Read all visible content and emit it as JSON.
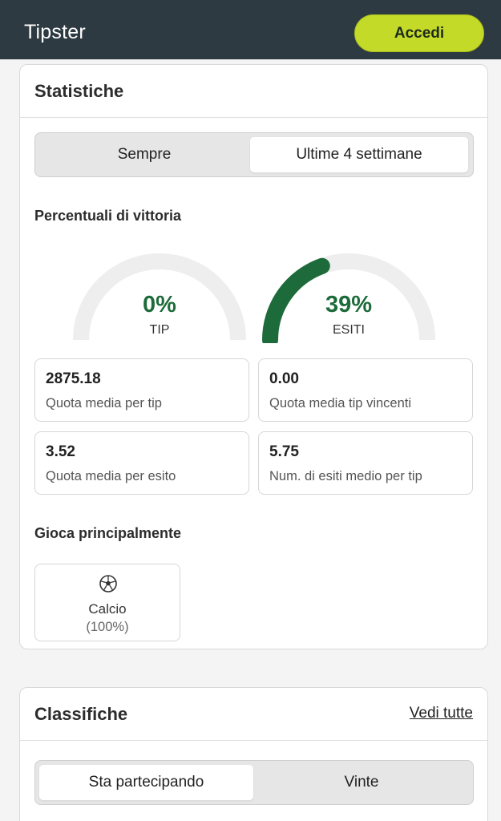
{
  "header": {
    "title": "Tipster",
    "login_label": "Accedi"
  },
  "stats_card": {
    "title": "Statistiche",
    "period_tabs": [
      {
        "label": "Sempre",
        "active": false
      },
      {
        "label": "Ultime 4 settimane",
        "active": true
      }
    ],
    "win_section_title": "Percentuali di vittoria",
    "gauges": [
      {
        "value": "0%",
        "label": "TIP",
        "fraction": 0.0
      },
      {
        "value": "39%",
        "label": "ESITI",
        "fraction": 0.39
      }
    ],
    "gauge_colors": {
      "track": "#eeeeee",
      "fill": "#1d6b3a"
    },
    "metrics": [
      {
        "value": "2875.18",
        "label": "Quota media per tip"
      },
      {
        "value": "0.00",
        "label": "Quota media tip vincenti"
      },
      {
        "value": "3.52",
        "label": "Quota media per esito"
      },
      {
        "value": "5.75",
        "label": "Num. di esiti medio per tip"
      }
    ],
    "plays_section_title": "Gioca principalmente",
    "sports": [
      {
        "icon": "soccer-ball-icon",
        "name": "Calcio",
        "share": "(100%)"
      }
    ]
  },
  "rank_card": {
    "title": "Classifiche",
    "see_all_label": "Vedi tutte",
    "tabs": [
      {
        "label": "Sta partecipando",
        "active": true
      },
      {
        "label": "Vinte",
        "active": false
      }
    ]
  },
  "colors": {
    "topbar": "#2e3a42",
    "accent": "#c4da28",
    "positive": "#1d6b3a"
  }
}
